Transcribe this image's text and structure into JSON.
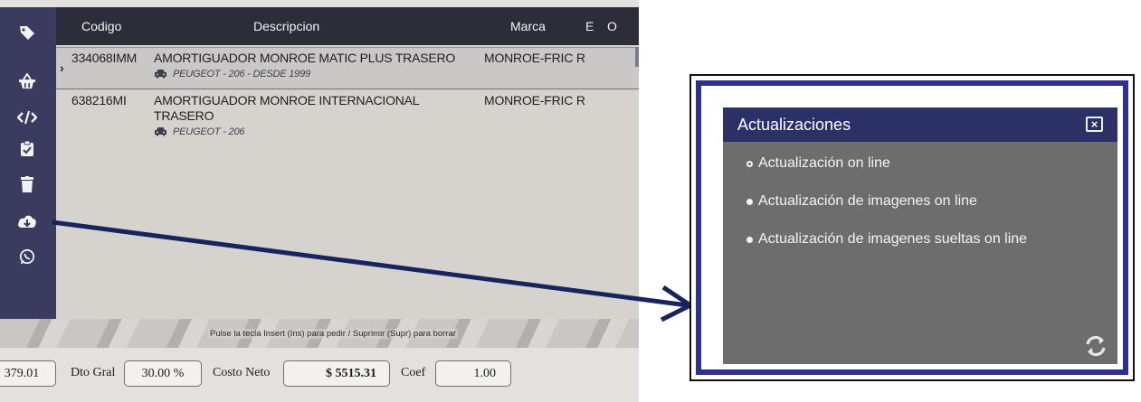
{
  "sidebar": {
    "icons": [
      "tag-icon",
      "basket-icon",
      "code-icon",
      "clipboard-check-icon",
      "trash-icon",
      "cloud-download-icon",
      "whatsapp-icon"
    ]
  },
  "grid": {
    "headers": {
      "codigo": "Codigo",
      "descripcion": "Descripcion",
      "marca": "Marca",
      "e": "E",
      "o": "O"
    },
    "rows": [
      {
        "codigo": "334068IMM",
        "descripcion": "AMORTIGUADOR MONROE MATIC PLUS TRASERO",
        "vehiculo": "PEUGEOT - 206  - DESDE 1999",
        "marca": "MONROE-FRIC R"
      },
      {
        "codigo": "638216MI",
        "descripcion": "AMORTIGUADOR MONROE INTERNACIONAL TRASERO",
        "vehiculo": "PEUGEOT - 206",
        "marca": "MONROE-FRIC R"
      }
    ]
  },
  "hint": "Pulse la tecla Insert (Ins) para pedir / Suprimir (Supr) para borrar",
  "footer": {
    "partial_value": "379.01",
    "dto_label": "Dto Gral",
    "dto_value": "30.00 %",
    "costo_label": "Costo Neto",
    "costo_value": "$ 5515.31",
    "coef_label": "Coef",
    "coef_value": "1.00"
  },
  "popup": {
    "title": "Actualizaciones",
    "close": "×",
    "options": [
      "Actualización on line",
      "Actualización de imagenes on line",
      "Actualización de imagenes sueltas on line"
    ]
  },
  "colors": {
    "sidebar": "#3b3b60",
    "header": "#2d2d3a",
    "popup_title": "#2b3166",
    "popup_body": "#6d6d6d",
    "frame_border": "#2e3190",
    "arrow": "#17245e"
  }
}
